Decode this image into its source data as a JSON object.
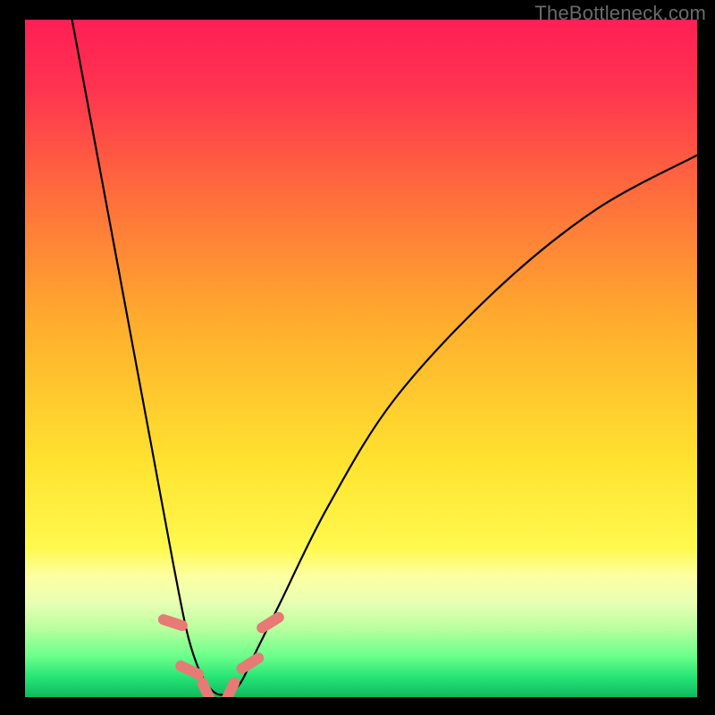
{
  "watermark": "TheBottleneck.com",
  "chart_data": {
    "type": "line",
    "title": "",
    "xlabel": "",
    "ylabel": "",
    "xlim": [
      0,
      100
    ],
    "ylim": [
      0,
      100
    ],
    "background_gradient": {
      "stops": [
        {
          "pos": 0.0,
          "color": "#ff1f55"
        },
        {
          "pos": 0.1,
          "color": "#ff3350"
        },
        {
          "pos": 0.25,
          "color": "#ff6a3d"
        },
        {
          "pos": 0.45,
          "color": "#ffae2d"
        },
        {
          "pos": 0.65,
          "color": "#ffe22f"
        },
        {
          "pos": 0.78,
          "color": "#fff94e"
        },
        {
          "pos": 0.82,
          "color": "#fdffa0"
        },
        {
          "pos": 0.86,
          "color": "#e9ffb4"
        },
        {
          "pos": 0.9,
          "color": "#b7ff9e"
        },
        {
          "pos": 0.94,
          "color": "#6aff8a"
        },
        {
          "pos": 0.97,
          "color": "#27e576"
        },
        {
          "pos": 1.0,
          "color": "#0fb85f"
        }
      ]
    },
    "series": [
      {
        "name": "bottleneck-curve",
        "x": [
          7,
          10,
          13,
          16,
          19,
          22,
          24,
          25.5,
          27,
          28.5,
          30,
          32,
          34,
          38,
          45,
          55,
          70,
          85,
          100
        ],
        "y": [
          100,
          84,
          68,
          52,
          36,
          20,
          10,
          5,
          2,
          0.5,
          0.5,
          2,
          6,
          14,
          28,
          44,
          60,
          72,
          80
        ]
      }
    ],
    "markers": [
      {
        "x": 22.0,
        "y": 11,
        "angle": -72
      },
      {
        "x": 24.5,
        "y": 4,
        "angle": -65
      },
      {
        "x": 27.0,
        "y": 0.8,
        "angle": -25
      },
      {
        "x": 30.5,
        "y": 0.8,
        "angle": 25
      },
      {
        "x": 33.5,
        "y": 5,
        "angle": 58
      },
      {
        "x": 36.5,
        "y": 11,
        "angle": 58
      }
    ]
  }
}
